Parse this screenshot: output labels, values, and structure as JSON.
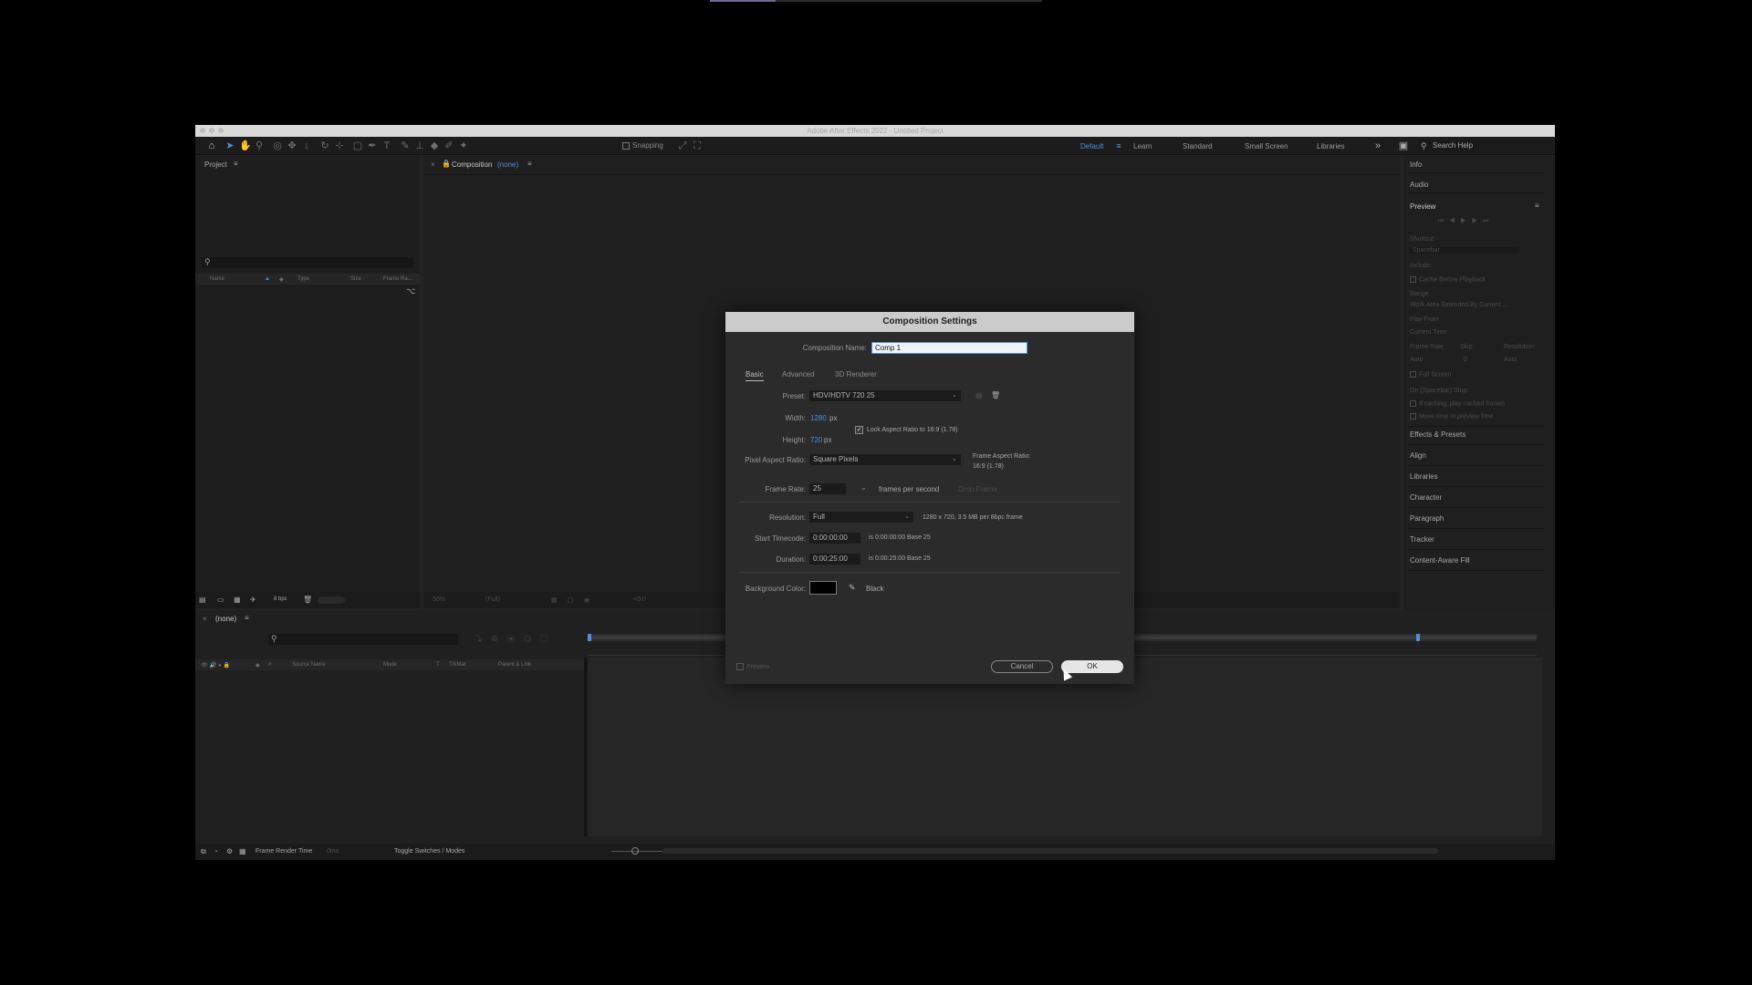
{
  "app": {
    "window_title": "Adobe After Effects 2022 - Untitled Project",
    "toolbar": {
      "snapping_label": "Snapping",
      "workspaces": [
        "Default",
        "Learn",
        "Standard",
        "Small Screen",
        "Libraries"
      ],
      "active_workspace": "Default",
      "search_help": "Search Help"
    },
    "project_panel": {
      "title": "Project",
      "columns": [
        "Name",
        "Type",
        "Size",
        "Frame Ra..."
      ],
      "bpc": "8 bpc"
    },
    "composition_panel": {
      "title": "Composition",
      "comp_name": "(none)",
      "zoom": "50%",
      "quality": "(Full)",
      "exposure": "+0.0"
    },
    "timeline_panel": {
      "tab": "(none)",
      "columns": [
        "Source Name",
        "Mode",
        "T",
        "TrkMat",
        "Parent & Link"
      ],
      "footer_render": "Frame Render Time",
      "footer_render_value": "0ms",
      "footer_toggle": "Toggle Switches / Modes"
    },
    "right_panels": {
      "top": [
        "Info",
        "Audio"
      ],
      "preview": {
        "title": "Preview",
        "shortcut_label": "Shortcut",
        "shortcut_value": "Spacebar",
        "include_label": "Include:",
        "cache_before": "Cache Before Playback",
        "range_label": "Range",
        "range_value": "Work Area Extended By Current ...",
        "play_from_label": "Play From",
        "play_from_value": "Current Time",
        "frame_rate_label": "Frame Rate",
        "skip_label": "Skip",
        "resolution_label": "Resolution",
        "frame_rate_value": "Auto",
        "skip_value": "0",
        "resolution_value": "Auto",
        "full_screen": "Full Screen",
        "on_stop_label": "On (Spacebar) Stop:",
        "if_caching": "If caching, play cached frames",
        "move_time": "Move time to preview time"
      },
      "bottom": [
        "Effects & Presets",
        "Align",
        "Libraries",
        "Character",
        "Paragraph",
        "Tracker",
        "Content-Aware Fill"
      ]
    }
  },
  "dialog": {
    "title": "Composition Settings",
    "composition_name_label": "Composition Name:",
    "composition_name_value": "Comp 1",
    "tabs": [
      "Basic",
      "Advanced",
      "3D Renderer"
    ],
    "active_tab": "Basic",
    "preset_label": "Preset:",
    "preset_value": "HDV/HDTV 720 25",
    "width_label": "Width:",
    "width_value": "1280",
    "height_label": "Height:",
    "height_value": "720",
    "unit_px": "px",
    "lock_aspect_label": "Lock Aspect Ratio to 16:9 (1.78)",
    "lock_aspect_checked": true,
    "pixel_aspect_label": "Pixel Aspect Ratio:",
    "pixel_aspect_value": "Square Pixels",
    "frame_aspect_label": "Frame Aspect Ratio:",
    "frame_aspect_value": "16:9 (1.78)",
    "frame_rate_label": "Frame Rate:",
    "frame_rate_value": "25",
    "frame_rate_unit": "frames per second",
    "drop_frame": "Drop Frame",
    "resolution_label": "Resolution:",
    "resolution_value": "Full",
    "resolution_info": "1280 x 720, 3.5 MB per 8bpc frame",
    "start_timecode_label": "Start Timecode:",
    "start_timecode_value": "0:00:00:00",
    "start_timecode_info": "is 0:00:00:00  Base 25",
    "duration_label": "Duration:",
    "duration_value": "0:00:25:00",
    "duration_info": "is 0:00:25:00  Base 25",
    "background_label": "Background Color:",
    "background_name": "Black",
    "background_color": "#000000",
    "preview_label": "Preview",
    "cancel_label": "Cancel",
    "ok_label": "OK"
  },
  "colors": {
    "accent": "#4f8fe0",
    "panel": "#1e1e1e",
    "dialog": "#2b2b2b"
  }
}
